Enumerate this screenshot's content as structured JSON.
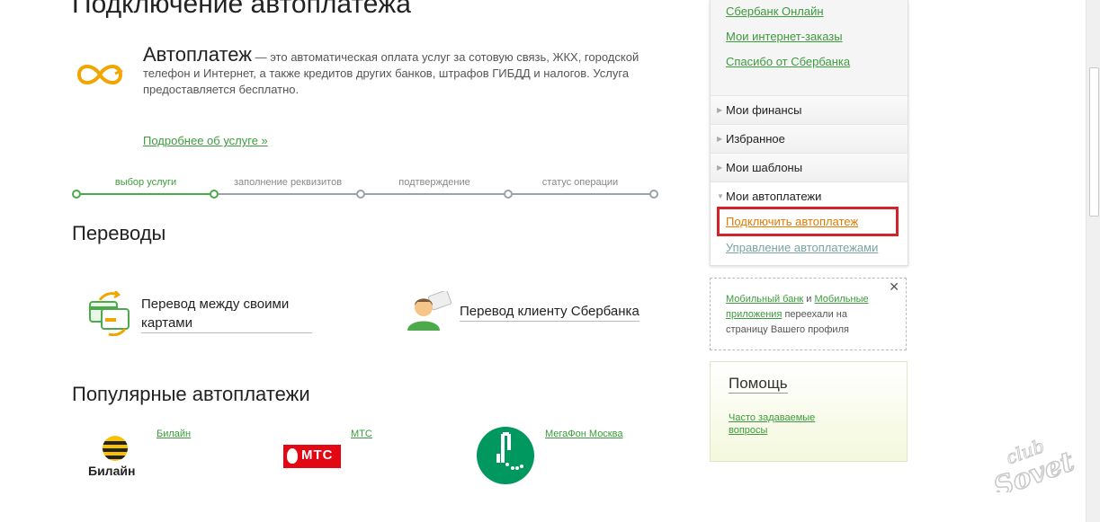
{
  "page_title": "Подключение автоплатежа",
  "intro": {
    "term": "Автоплатеж",
    "description": " — это автоматическая оплата услуг за сотовую связь, ЖКХ, городской телефон и Интернет, а также кредитов других банков, штрафов ГИБДД и налогов. Услуга предоставляется бесплатно.",
    "more_link": "Подробнее об услуге »"
  },
  "steps": [
    {
      "label": "выбор услуги",
      "active": true
    },
    {
      "label": "заполнение реквизитов",
      "active": false
    },
    {
      "label": "подтверждение",
      "active": false
    },
    {
      "label": "статус операции",
      "active": false
    }
  ],
  "transfers": {
    "heading": "Переводы",
    "between_cards": "Перевод между своими картами",
    "to_client": "Перевод клиенту Сбербанка"
  },
  "popular": {
    "heading": "Популярные автоплатежи",
    "operators": [
      "Билайн",
      "МТС",
      "МегаФон Москва"
    ],
    "beeline_logo_text": "Билайн",
    "mts_logo_text": "МТС"
  },
  "sidebar": {
    "links": [
      "Сбербанк Онлайн",
      "Мои интернет-заказы",
      "Спасибо от Сбербанка"
    ],
    "items": [
      "Мои финансы",
      "Избранное",
      "Мои шаблоны",
      "Мои автоплатежи"
    ],
    "sub_items": [
      "Подключить автоплатеж",
      "Управление автоплатежами"
    ]
  },
  "notice": {
    "link1": "Мобильный банк",
    "and": " и ",
    "link2": "Мобильные приложения",
    "text": " переехали на страницу Вашего профиля",
    "close": "✕"
  },
  "help": {
    "title": "Помощь",
    "faq": "Часто задаваемые вопросы"
  },
  "colors": {
    "accent_green": "#3c9b3c",
    "highlight_red": "#d4222a",
    "active_orange": "#e07b00"
  }
}
